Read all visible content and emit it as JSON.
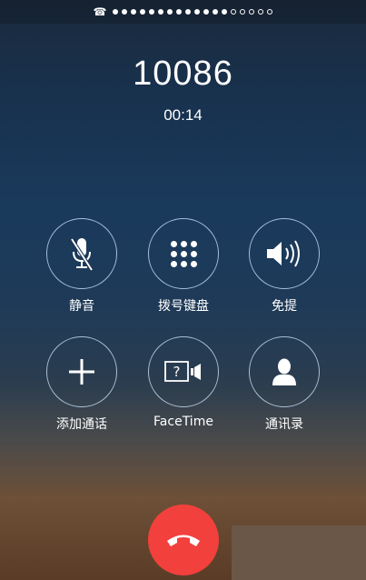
{
  "status_bar": {
    "phone_glyph": "☎",
    "filled_dots": 13,
    "empty_dots": 5
  },
  "call": {
    "number": "10086",
    "duration": "00:14"
  },
  "controls": {
    "mute": {
      "label": "静音",
      "icon": "microphone-muted-icon"
    },
    "keypad": {
      "label": "拨号键盘",
      "icon": "keypad-icon"
    },
    "speaker": {
      "label": "免提",
      "icon": "speaker-icon"
    },
    "add_call": {
      "label": "添加通话",
      "icon": "plus-icon"
    },
    "facetime": {
      "label": "FaceTime",
      "icon": "facetime-question-icon",
      "icon_text": "?"
    },
    "contacts": {
      "label": "通讯录",
      "icon": "person-icon"
    }
  },
  "end_call": {
    "icon": "hang-up-icon",
    "color": "#f2403d"
  },
  "colors": {
    "circle_border": "#bed7f0",
    "text": "#ffffff"
  }
}
